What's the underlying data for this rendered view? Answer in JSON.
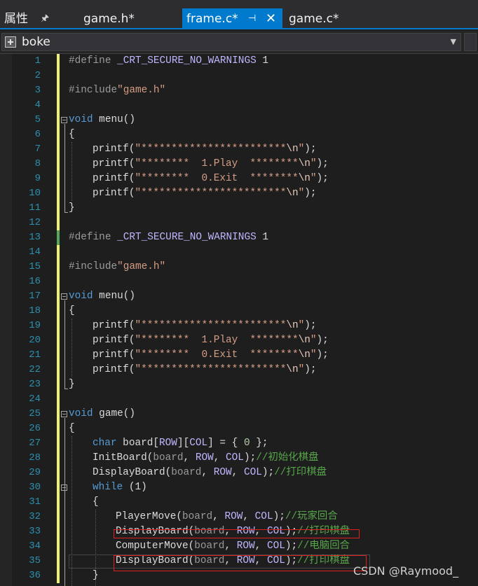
{
  "tabs": {
    "properties_label": "属性",
    "pin_glyph": "🖈",
    "game_h": "game.h*",
    "frame_c": "frame.c*",
    "game_c": "game.c*",
    "close_glyph": "✕",
    "pin2_glyph": "⊣"
  },
  "navbar": {
    "scope": "boke",
    "caret": "▼"
  },
  "editor": {
    "line_numbers": [
      "1",
      "2",
      "3",
      "4",
      "5",
      "6",
      "7",
      "8",
      "9",
      "10",
      "11",
      "12",
      "13",
      "14",
      "15",
      "16",
      "17",
      "18",
      "19",
      "20",
      "21",
      "22",
      "23",
      "24",
      "25",
      "26",
      "27",
      "28",
      "29",
      "30",
      "31",
      "32",
      "33",
      "34",
      "35",
      "36"
    ]
  },
  "code": {
    "l1": [
      "#define ",
      "_CRT_SECURE_NO_WARNINGS",
      " 1"
    ],
    "l3": [
      "#include",
      "\"game.h\""
    ],
    "l5": [
      "void",
      " menu()"
    ],
    "l6": "{",
    "l7": [
      "printf(",
      "\"************************",
      "\\n",
      "\"",
      ");"
    ],
    "l8": [
      "printf(",
      "\"********  1.Play  ********",
      "\\n",
      "\"",
      ");"
    ],
    "l9": [
      "printf(",
      "\"********  0.Exit  ********",
      "\\n",
      "\"",
      ");"
    ],
    "l10": [
      "printf(",
      "\"************************",
      "\\n",
      "\"",
      ");"
    ],
    "l11": "}",
    "l13": [
      "#define ",
      "_CRT_SECURE_NO_WARNINGS",
      " 1"
    ],
    "l15": [
      "#include",
      "\"game.h\""
    ],
    "l17": [
      "void",
      " menu()"
    ],
    "l18": "{",
    "l19": [
      "printf(",
      "\"************************",
      "\\n",
      "\"",
      ");"
    ],
    "l20": [
      "printf(",
      "\"********  1.Play  ********",
      "\\n",
      "\"",
      ");"
    ],
    "l21": [
      "printf(",
      "\"********  0.Exit  ********",
      "\\n",
      "\"",
      ");"
    ],
    "l22": [
      "printf(",
      "\"************************",
      "\\n",
      "\"",
      ");"
    ],
    "l23": "}",
    "l25": [
      "void",
      " game()"
    ],
    "l26": "{",
    "l27": [
      "char",
      " board",
      "[",
      "ROW",
      "][",
      "COL",
      "] = { ",
      "0",
      " };"
    ],
    "l28": [
      "InitBoard(",
      "board",
      ", ",
      "ROW",
      ", ",
      "COL",
      ");",
      "//初始化棋盘"
    ],
    "l29": [
      "DisplayBoard(",
      "board",
      ", ",
      "ROW",
      ", ",
      "COL",
      ");",
      "//打印棋盘"
    ],
    "l30": [
      "while",
      " (1)"
    ],
    "l31": "{",
    "l32": [
      "PlayerMove(",
      "board",
      ", ",
      "ROW",
      ", ",
      "COL",
      ");",
      "//玩家回合"
    ],
    "l33": [
      "DisplayBoard(",
      "board",
      ", ",
      "ROW",
      ", ",
      "COL",
      ");",
      "//打印棋盘"
    ],
    "l34": [
      "ComputerMove(",
      "board",
      ", ",
      "ROW",
      ", ",
      "COL",
      ");",
      "//电脑回合"
    ],
    "l35": [
      "DisplayBoard(",
      "board",
      ", ",
      "ROW",
      ", ",
      "COL",
      ");",
      "//打印棋盘"
    ],
    "l36": "}"
  },
  "watermark": "CSDN @Raymood_",
  "colors": {
    "accent_tab": "#007acc",
    "keyword": "#569cd6",
    "string": "#d69d85",
    "comment": "#57a64a",
    "macro": "#beb7ff",
    "line_number": "#2b91af",
    "change_bar": "#efef6f",
    "highlight_box": "#e0201e"
  }
}
